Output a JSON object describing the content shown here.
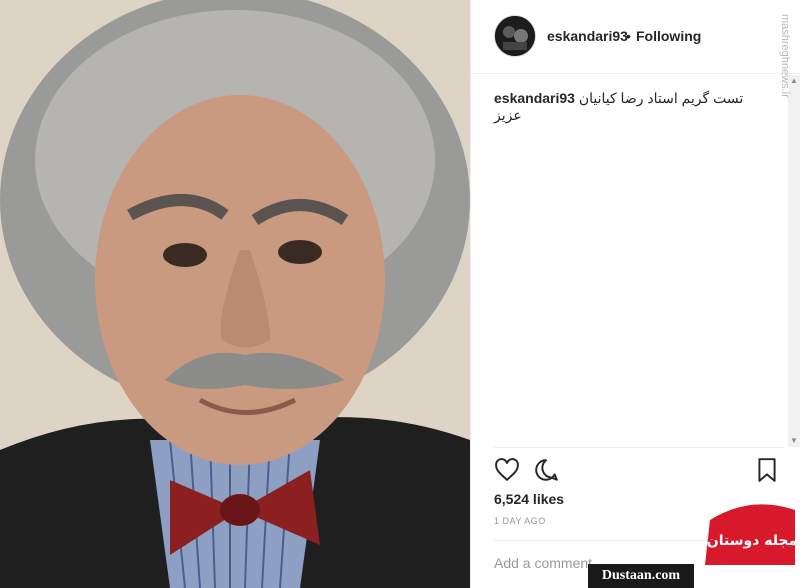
{
  "post": {
    "username": "eskandari93",
    "separator": "•",
    "follow_status": "Following",
    "caption_user": "eskandari93",
    "caption_text": "تست گریم استاد رضا کیانیان عزیز",
    "likes": "6,524 likes",
    "time_ago": "1 DAY AGO",
    "comment_placeholder": "Add a comment..."
  },
  "watermarks": {
    "side_text": "mashreghnews.ir",
    "badge_text": "مجله دوستان",
    "site_label": "Dustaan.com"
  },
  "icons": {
    "like": "heart-icon",
    "comment": "comment-icon",
    "save": "bookmark-icon"
  },
  "colors": {
    "text": "#262626",
    "muted": "#999999",
    "border": "#efefef",
    "badge_red": "#d7192b"
  }
}
